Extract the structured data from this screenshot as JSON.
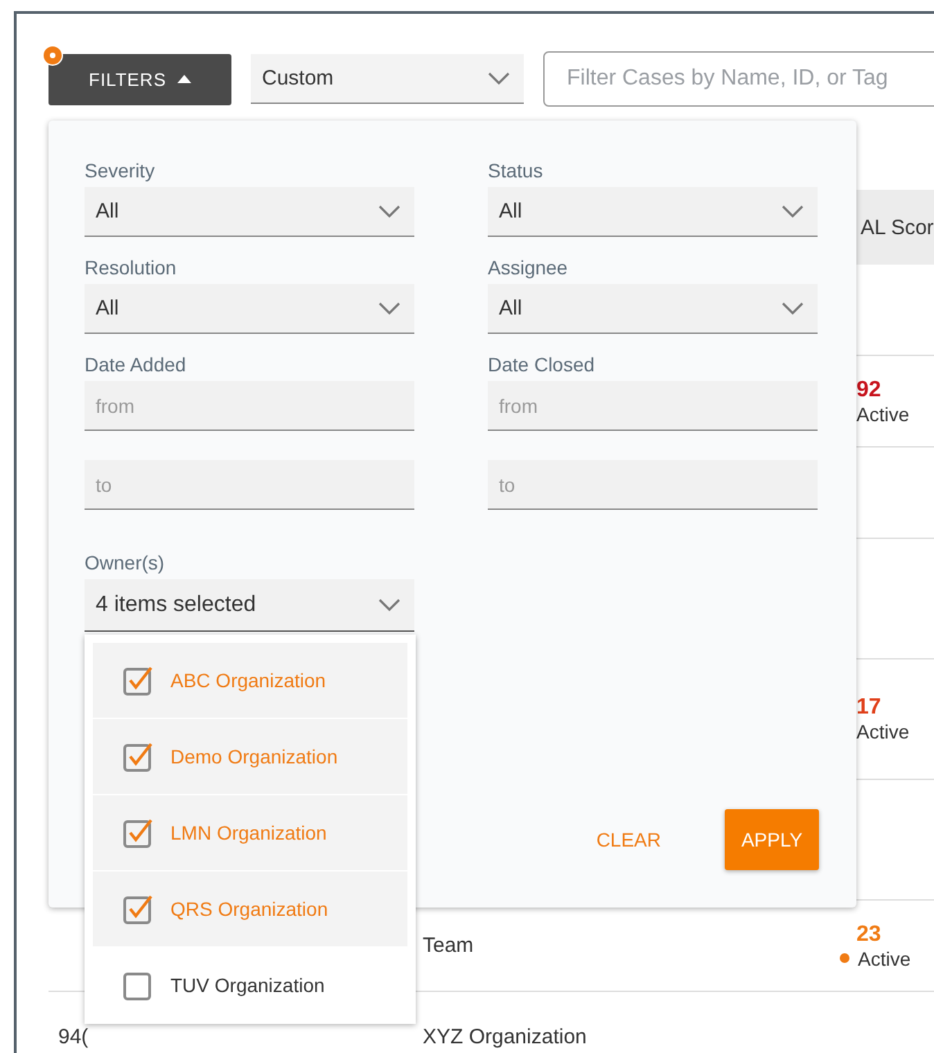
{
  "toolbar": {
    "filters_button": {
      "label": "FILTERS",
      "expanded": true
    },
    "preset": {
      "value": "Custom"
    },
    "search": {
      "placeholder": "Filter Cases by Name, ID, or Tag"
    }
  },
  "table": {
    "columns": [
      "AL Scor"
    ],
    "rows": [
      {},
      {
        "score": "92",
        "color": "#c8141e",
        "status": "Active"
      },
      {},
      {},
      {
        "score": "17",
        "color": "#e0401a",
        "status": "Active"
      },
      {},
      {
        "name": "Team",
        "score": "23",
        "color": "#f07b14",
        "status": "Active",
        "dot": true
      },
      {
        "id": "94(",
        "name": "XYZ Organization"
      }
    ]
  },
  "filter_panel": {
    "fields": [
      {
        "label": "Severity",
        "kind": "select",
        "value": "All"
      },
      {
        "label": "Status",
        "kind": "select",
        "value": "All"
      },
      {
        "label": "Resolution",
        "kind": "select",
        "value": "All"
      },
      {
        "label": "Assignee",
        "kind": "select",
        "value": "All"
      },
      {
        "label": "Date Added",
        "kind": "range",
        "from": {
          "placeholder": "from"
        },
        "to": {
          "placeholder": "to"
        }
      },
      {
        "label": "Date Closed",
        "kind": "range",
        "from": {
          "placeholder": "from"
        },
        "to": {
          "placeholder": "to"
        }
      }
    ],
    "owners": {
      "label": "Owner(s)",
      "value": "4 items selected",
      "expanded": true,
      "options": [
        {
          "label": "ABC Organization",
          "checked": true
        },
        {
          "label": "Demo Organization",
          "checked": true
        },
        {
          "label": "LMN Organization",
          "checked": true
        },
        {
          "label": "QRS Organization",
          "checked": true
        },
        {
          "label": "TUV Organization",
          "checked": false
        }
      ]
    },
    "buttons": {
      "clear": "CLEAR",
      "apply": "APPLY"
    }
  }
}
